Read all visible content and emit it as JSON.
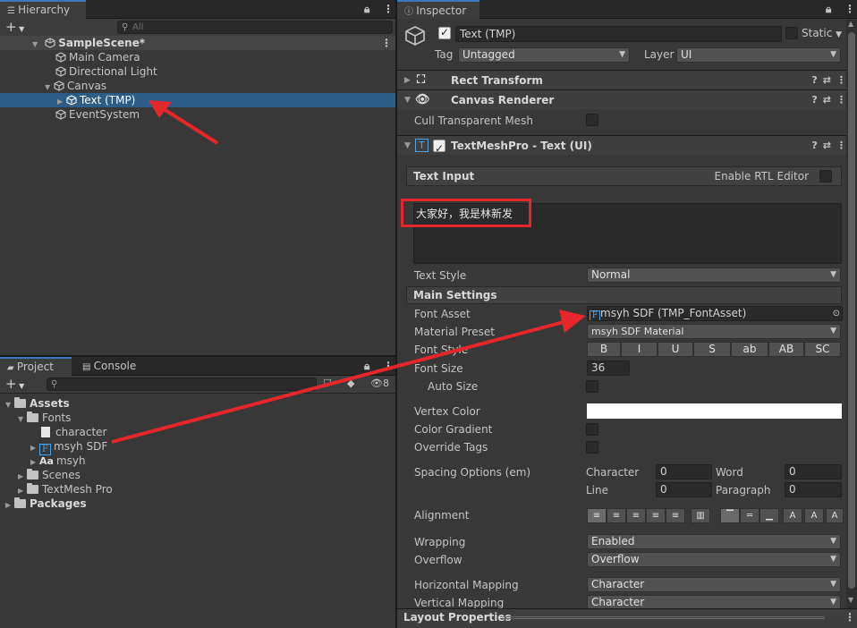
{
  "hierarchy": {
    "tab": "Hierarchy",
    "search_placeholder": "All",
    "items": [
      {
        "label": "SampleScene*"
      },
      {
        "label": "Main Camera"
      },
      {
        "label": "Directional Light"
      },
      {
        "label": "Canvas"
      },
      {
        "label": "Text (TMP)"
      },
      {
        "label": "EventSystem"
      }
    ]
  },
  "project": {
    "tab_project": "Project",
    "tab_console": "Console",
    "hidden_count": "8",
    "items": [
      {
        "label": "Assets"
      },
      {
        "label": "Fonts"
      },
      {
        "label": "character"
      },
      {
        "label": "msyh SDF"
      },
      {
        "label": "msyh"
      },
      {
        "label": "Scenes"
      },
      {
        "label": "TextMesh Pro"
      },
      {
        "label": "Packages"
      }
    ]
  },
  "inspector": {
    "tab": "Inspector",
    "object_name": "Text (TMP)",
    "static_label": "Static",
    "tag_label": "Tag",
    "tag_value": "Untagged",
    "layer_label": "Layer",
    "layer_value": "UI",
    "components": {
      "rect_transform": "Rect Transform",
      "canvas_renderer": "Canvas Renderer",
      "cull_label": "Cull Transparent Mesh",
      "tmp": "TextMeshPro - Text (UI)"
    },
    "text_input_label": "Text Input",
    "rtl_label": "Enable RTL Editor",
    "text_value": "大家好，我是林新发",
    "text_style_label": "Text Style",
    "text_style_value": "Normal",
    "main_settings": "Main Settings",
    "font_asset_label": "Font Asset",
    "font_asset_value": "msyh SDF (TMP_FontAsset)",
    "material_preset_label": "Material Preset",
    "material_preset_value": "msyh SDF Material",
    "font_style_label": "Font Style",
    "font_style_buttons": [
      "B",
      "I",
      "U",
      "S",
      "ab",
      "AB",
      "SC"
    ],
    "font_size_label": "Font Size",
    "font_size_value": "36",
    "auto_size_label": "Auto Size",
    "vertex_color_label": "Vertex Color",
    "vertex_color": "#ffffff",
    "color_gradient_label": "Color Gradient",
    "override_tags_label": "Override Tags",
    "spacing_label": "Spacing Options (em)",
    "spacing": {
      "character_label": "Character",
      "character_value": "0",
      "word_label": "Word",
      "word_value": "0",
      "line_label": "Line",
      "line_value": "0",
      "paragraph_label": "Paragraph",
      "paragraph_value": "0"
    },
    "alignment_label": "Alignment",
    "wrapping_label": "Wrapping",
    "wrapping_value": "Enabled",
    "overflow_label": "Overflow",
    "overflow_value": "Overflow",
    "hmapping_label": "Horizontal Mapping",
    "hmapping_value": "Character",
    "vmapping_label": "Vertical Mapping",
    "vmapping_value": "Character",
    "layout_properties": "Layout Properties"
  },
  "colors": {
    "selection": "#2c5d87",
    "highlight_box": "#e5262b",
    "arrow": "#e5262b"
  }
}
